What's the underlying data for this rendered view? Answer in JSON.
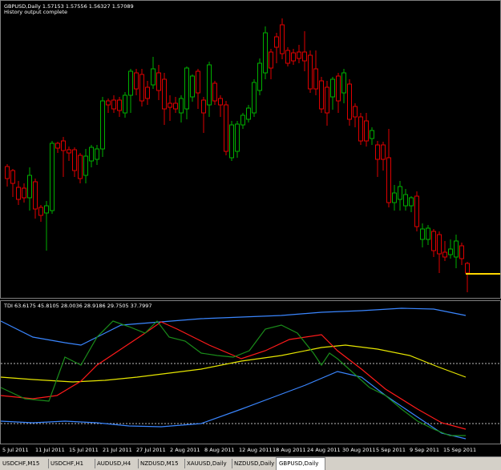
{
  "chart_header": {
    "symbol_line": "GBPUSD,Daily  1.57153 1.57556 1.56327 1.57089",
    "status_line": "History output complete"
  },
  "indicator_header": {
    "label": "TDI 63.6175 45.8105 28.0036 28.9186 29.7505 37.7997"
  },
  "x_axis": {
    "ticks": [
      "5 Jul 2011",
      "11 Jul 2011",
      "15 Jul 2011",
      "21 Jul 2011",
      "27 Jul 2011",
      "2 Aug 2011",
      "8 Aug 2011",
      "12 Aug 2011",
      "18 Aug 2011",
      "24 Aug 2011",
      "30 Aug 2011",
      "5 Sep 2011",
      "9 Sep 2011",
      "15 Sep 2011"
    ]
  },
  "tabs": [
    {
      "label": "USDCHF,M15",
      "active": false
    },
    {
      "label": "USDCHF,H1",
      "active": false
    },
    {
      "label": "AUDUSD,H4",
      "active": false
    },
    {
      "label": "NZDUSD,M15",
      "active": false
    },
    {
      "label": "XAUUSD,Daily",
      "active": false
    },
    {
      "label": "NZDUSD,Daily",
      "active": false
    },
    {
      "label": "GBPUSD,Daily",
      "active": true
    }
  ],
  "colors": {
    "bull": "#00b000",
    "bear": "#e00000",
    "blue": "#3a86ff",
    "red": "#ff1a1a",
    "green": "#1a8c1a",
    "yellow": "#e6e600",
    "price_line": "#ffd700"
  },
  "chart_data": {
    "type": "candlestick",
    "title": "GBPUSD,Daily",
    "current_price": 1.57089
  }
}
